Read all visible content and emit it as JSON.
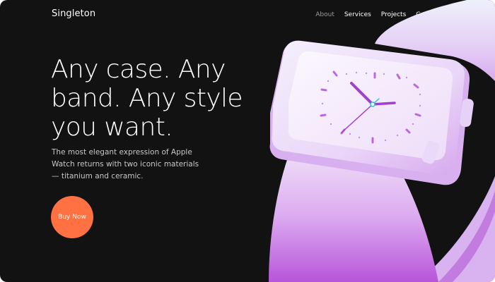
{
  "brand": {
    "name": "Singleton"
  },
  "nav": {
    "items": [
      {
        "label": "About",
        "active": true
      },
      {
        "label": "Services",
        "active": false
      },
      {
        "label": "Projects",
        "active": false
      },
      {
        "label": "Contacts",
        "active": false
      }
    ]
  },
  "hero": {
    "headline": "Any case. Any band. Any style you want.",
    "subtitle": "The most elegant expression of Apple Watch returns with two iconic materials — titanium and ceramic.",
    "cta_label": "Buy Now"
  },
  "colors": {
    "background": "#121212",
    "accent": "#ff7043",
    "watch_light": "#f2e8fb",
    "watch_mid": "#d8a8ee",
    "watch_dark": "#b554d8",
    "hands": "#a23fd0"
  },
  "image": {
    "subject": "smartwatch-illustration"
  }
}
